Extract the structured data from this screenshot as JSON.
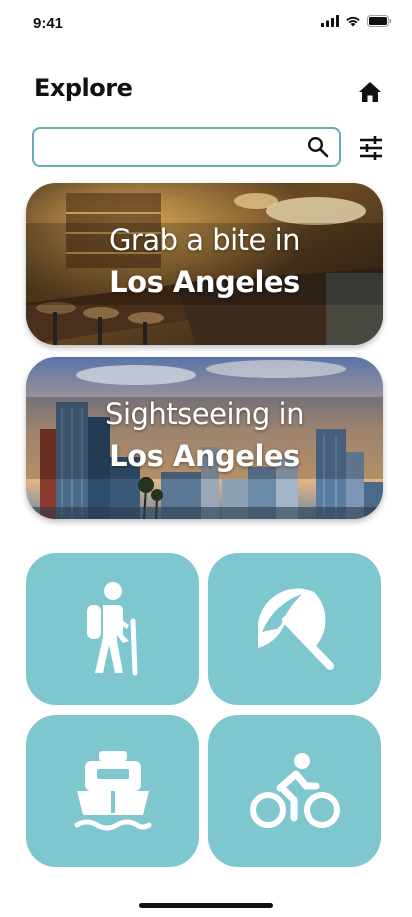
{
  "status": {
    "time": "9:41",
    "icons": [
      "cellular-signal-icon",
      "wifi-icon",
      "battery-icon"
    ]
  },
  "header": {
    "title": "Explore",
    "home_icon": "home-icon"
  },
  "search": {
    "value": "",
    "placeholder": "",
    "icon": "search-icon",
    "filter_icon": "filter-sliders-icon",
    "border_color": "#6aaab1"
  },
  "cards": [
    {
      "line1": "Grab a bite in",
      "line2": "Los Angeles"
    },
    {
      "line1": "Sightseeing in",
      "line2": "Los Angeles"
    }
  ],
  "tiles": {
    "color": "#7fc7cf",
    "items": [
      {
        "icon": "hiking-icon"
      },
      {
        "icon": "beach-umbrella-icon"
      },
      {
        "icon": "ferry-boat-icon"
      },
      {
        "icon": "cycling-icon"
      }
    ]
  }
}
